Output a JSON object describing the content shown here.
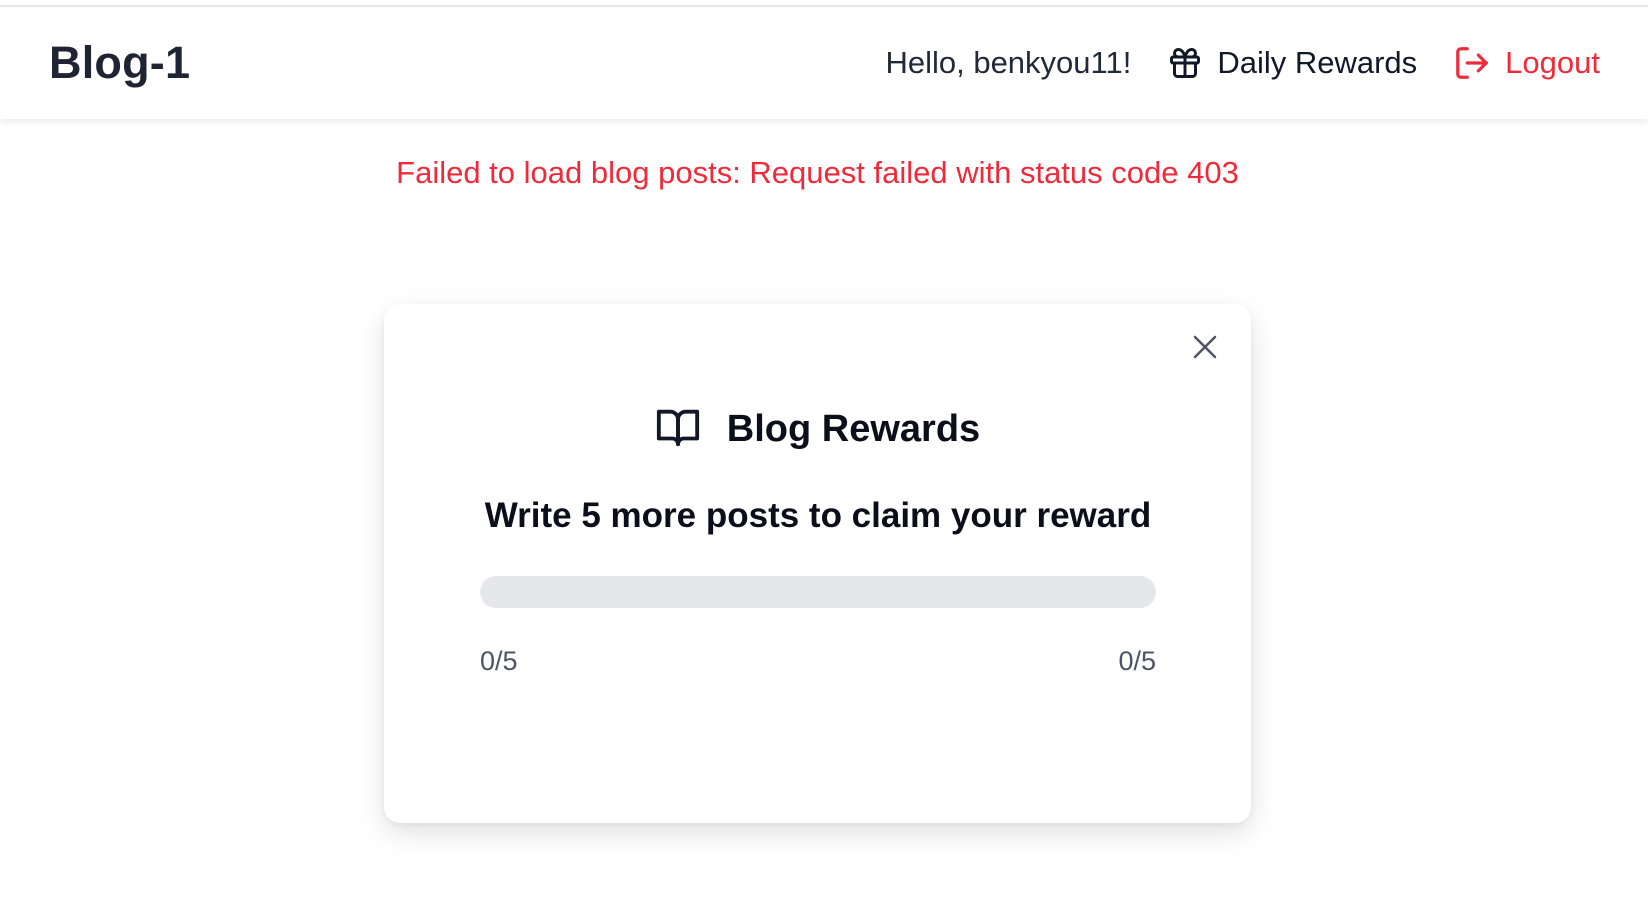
{
  "header": {
    "brand": "Blog-1",
    "greeting": "Hello, benkyou11!",
    "daily_rewards_label": "Daily Rewards",
    "logout_label": "Logout",
    "daily_rewards_icon": "gift-icon",
    "logout_icon": "logout-icon"
  },
  "error": {
    "message": "Failed to load blog posts: Request failed with status code 403"
  },
  "modal": {
    "title": "Blog Rewards",
    "title_icon": "book-open-icon",
    "close_icon": "close-icon",
    "message": "Write 5 more posts to claim your reward",
    "progress": {
      "current": 0,
      "total": 5,
      "fraction": 0.0,
      "left_label": "0/5",
      "right_label": "0/5"
    }
  },
  "colors": {
    "brand_text": "#1e2432",
    "error": "#ef2b3b",
    "logout": "#ef2b3b",
    "progress_track": "#e5e7eb",
    "progress_fill": "#3b82f6"
  }
}
